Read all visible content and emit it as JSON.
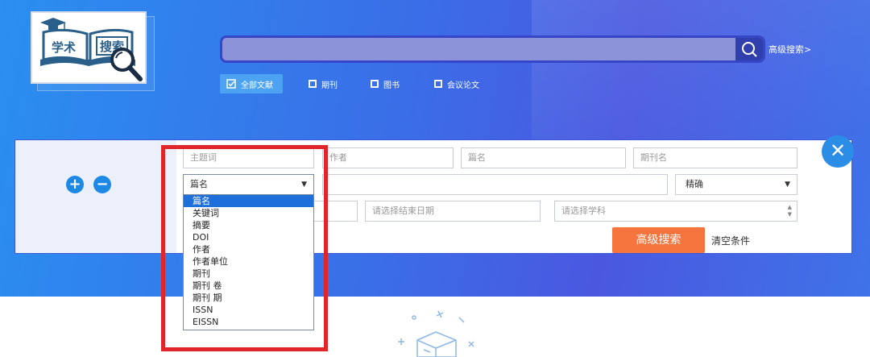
{
  "logo": {
    "text_left": "学术",
    "text_right": "搜索"
  },
  "search": {
    "placeholder": "",
    "advanced_link": "高级搜索>"
  },
  "type_filters": [
    {
      "label": "全部文献",
      "checked": true
    },
    {
      "label": "期刊",
      "checked": false
    },
    {
      "label": "图书",
      "checked": false
    },
    {
      "label": "会议论文",
      "checked": false
    }
  ],
  "advanced": {
    "row1": [
      "主题词",
      "作者",
      "篇名",
      "期刊名"
    ],
    "field_select": "篇名",
    "match_select": "精确",
    "end_date_placeholder": "请选择结束日期",
    "subject_placeholder": "请选择学科",
    "search_button": "高级搜索",
    "clear_link": "清空条件",
    "add_icon": "+",
    "remove_icon": "−",
    "close_icon": "✕"
  },
  "dropdown_options": [
    "篇名",
    "关键词",
    "摘要",
    "DOI",
    "作者",
    "作者单位",
    "期刊",
    "期刊 卷",
    "期刊 期",
    "ISSN",
    "EISSN"
  ],
  "colors": {
    "accent": "#1e6fd9",
    "button": "#f6743d",
    "highlight": "#e0262b"
  }
}
